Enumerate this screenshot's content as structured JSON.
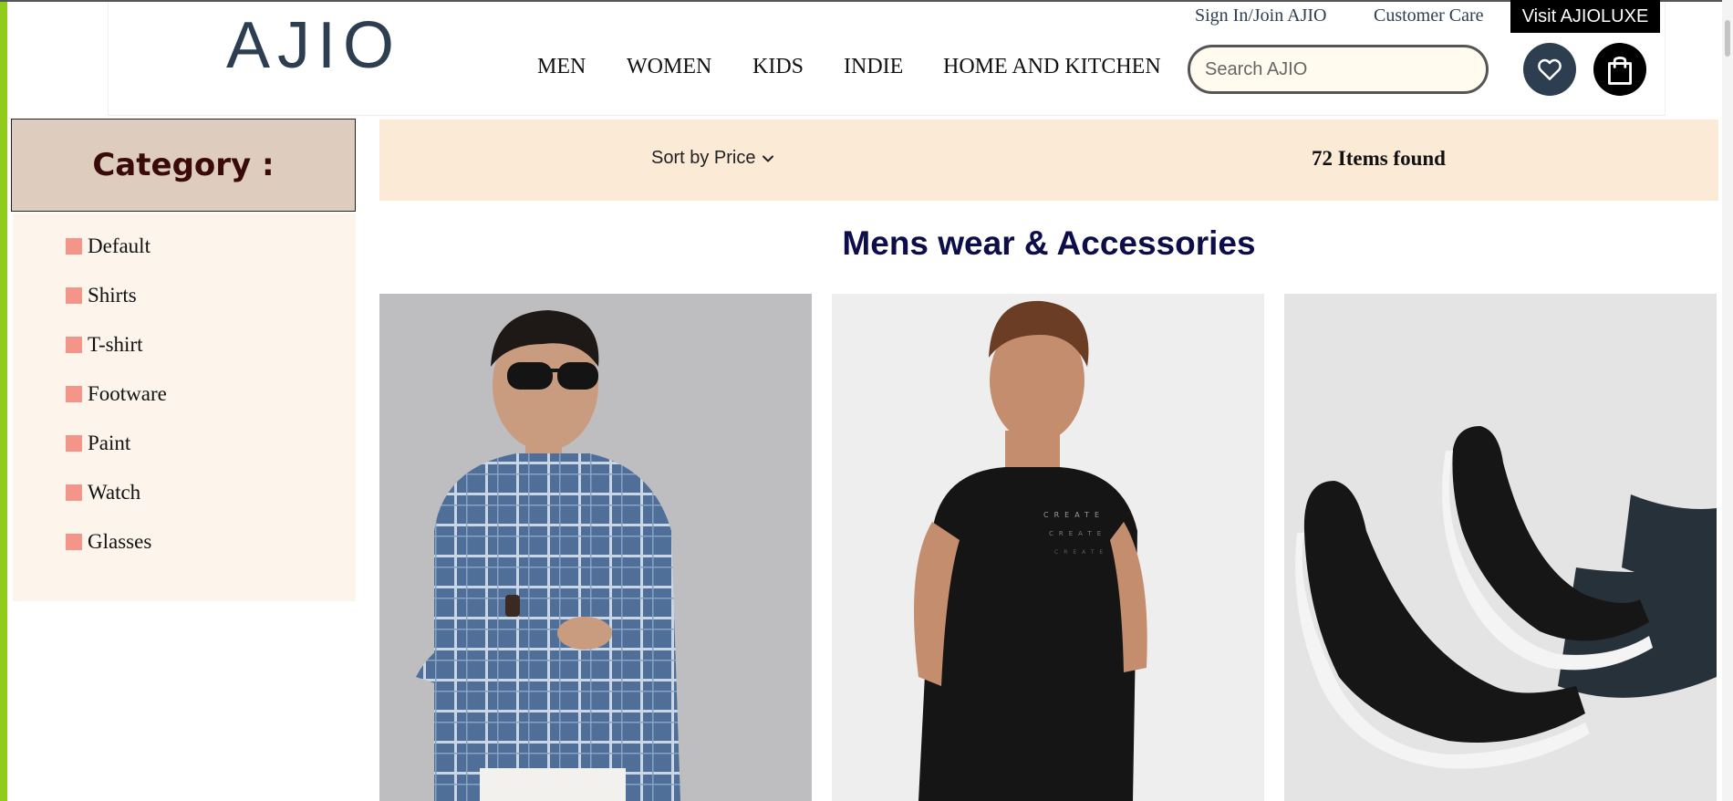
{
  "header": {
    "logo": "AJIO",
    "sign_in": "Sign In/Join AJIO",
    "customer_care": "Customer Care",
    "luxe_button": "Visit AJIOLUXE",
    "search_placeholder": "Search AJIO",
    "nav": [
      "MEN",
      "WOMEN",
      "KIDS",
      "INDIE",
      "HOME AND KITCHEN"
    ],
    "icons": [
      "heart-icon",
      "shopping-bag-icon"
    ]
  },
  "sidebar": {
    "title": "Category :",
    "items": [
      "Default",
      "Shirts",
      "T-shirt",
      "Footware",
      "Paint",
      "Watch",
      "Glasses"
    ]
  },
  "toolbar": {
    "sort_label": "Sort by Price",
    "items_found": "72 Items found"
  },
  "main": {
    "section_title": "Mens wear & Accessories"
  },
  "colors": {
    "accent_green": "#8fcc1c",
    "brand_navy": "#2c3e50",
    "category_header_bg": "#decdbe",
    "sort_bar_bg": "#fbead6",
    "category_bullet": "#f4958a"
  }
}
